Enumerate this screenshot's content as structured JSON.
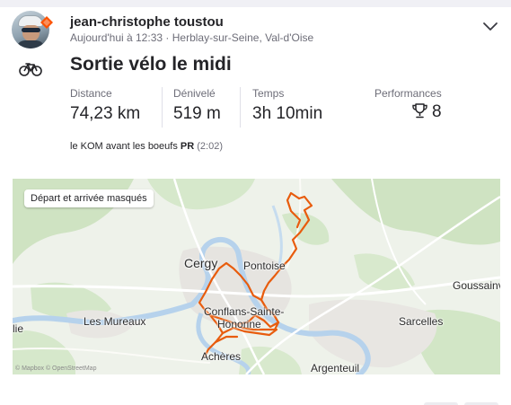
{
  "athlete": {
    "name": "jean-christophe toustou",
    "date_time": "Aujourd'hui à 12:33",
    "separator": "·",
    "location": "Herblay-sur-Seine, Val-d'Oise"
  },
  "activity": {
    "sport_icon": "bike-icon",
    "title": "Sortie vélo le midi"
  },
  "stats": [
    {
      "label": "Distance",
      "value": "74,23 km"
    },
    {
      "label": "Dénivelé",
      "value": "519 m"
    },
    {
      "label": "Temps",
      "value": "3h 10min"
    },
    {
      "label": "Performances",
      "value": "8",
      "icon": "trophy-icon"
    }
  ],
  "achievement": {
    "segment": "le KOM avant les boeufs",
    "badge": "PR",
    "time": "(2:02)"
  },
  "map": {
    "privacy_label": "Départ et arrivée masqués",
    "copyright": "© Mapbox © OpenStreetMap",
    "route_color": "#e85c0d",
    "places": [
      {
        "name": "Cergy"
      },
      {
        "name": "Pontoise"
      },
      {
        "name": "Goussainv"
      },
      {
        "name": "Conflans-Sainte-"
      },
      {
        "name": "Honorine"
      },
      {
        "name": "Les Mureaux"
      },
      {
        "name": "Sarcelles"
      },
      {
        "name": "lie"
      },
      {
        "name": "Achères"
      },
      {
        "name": "Argenteuil"
      }
    ]
  },
  "colors": {
    "brand": "#fc5200",
    "text_primary": "#242428",
    "text_secondary": "#6d6d78"
  }
}
